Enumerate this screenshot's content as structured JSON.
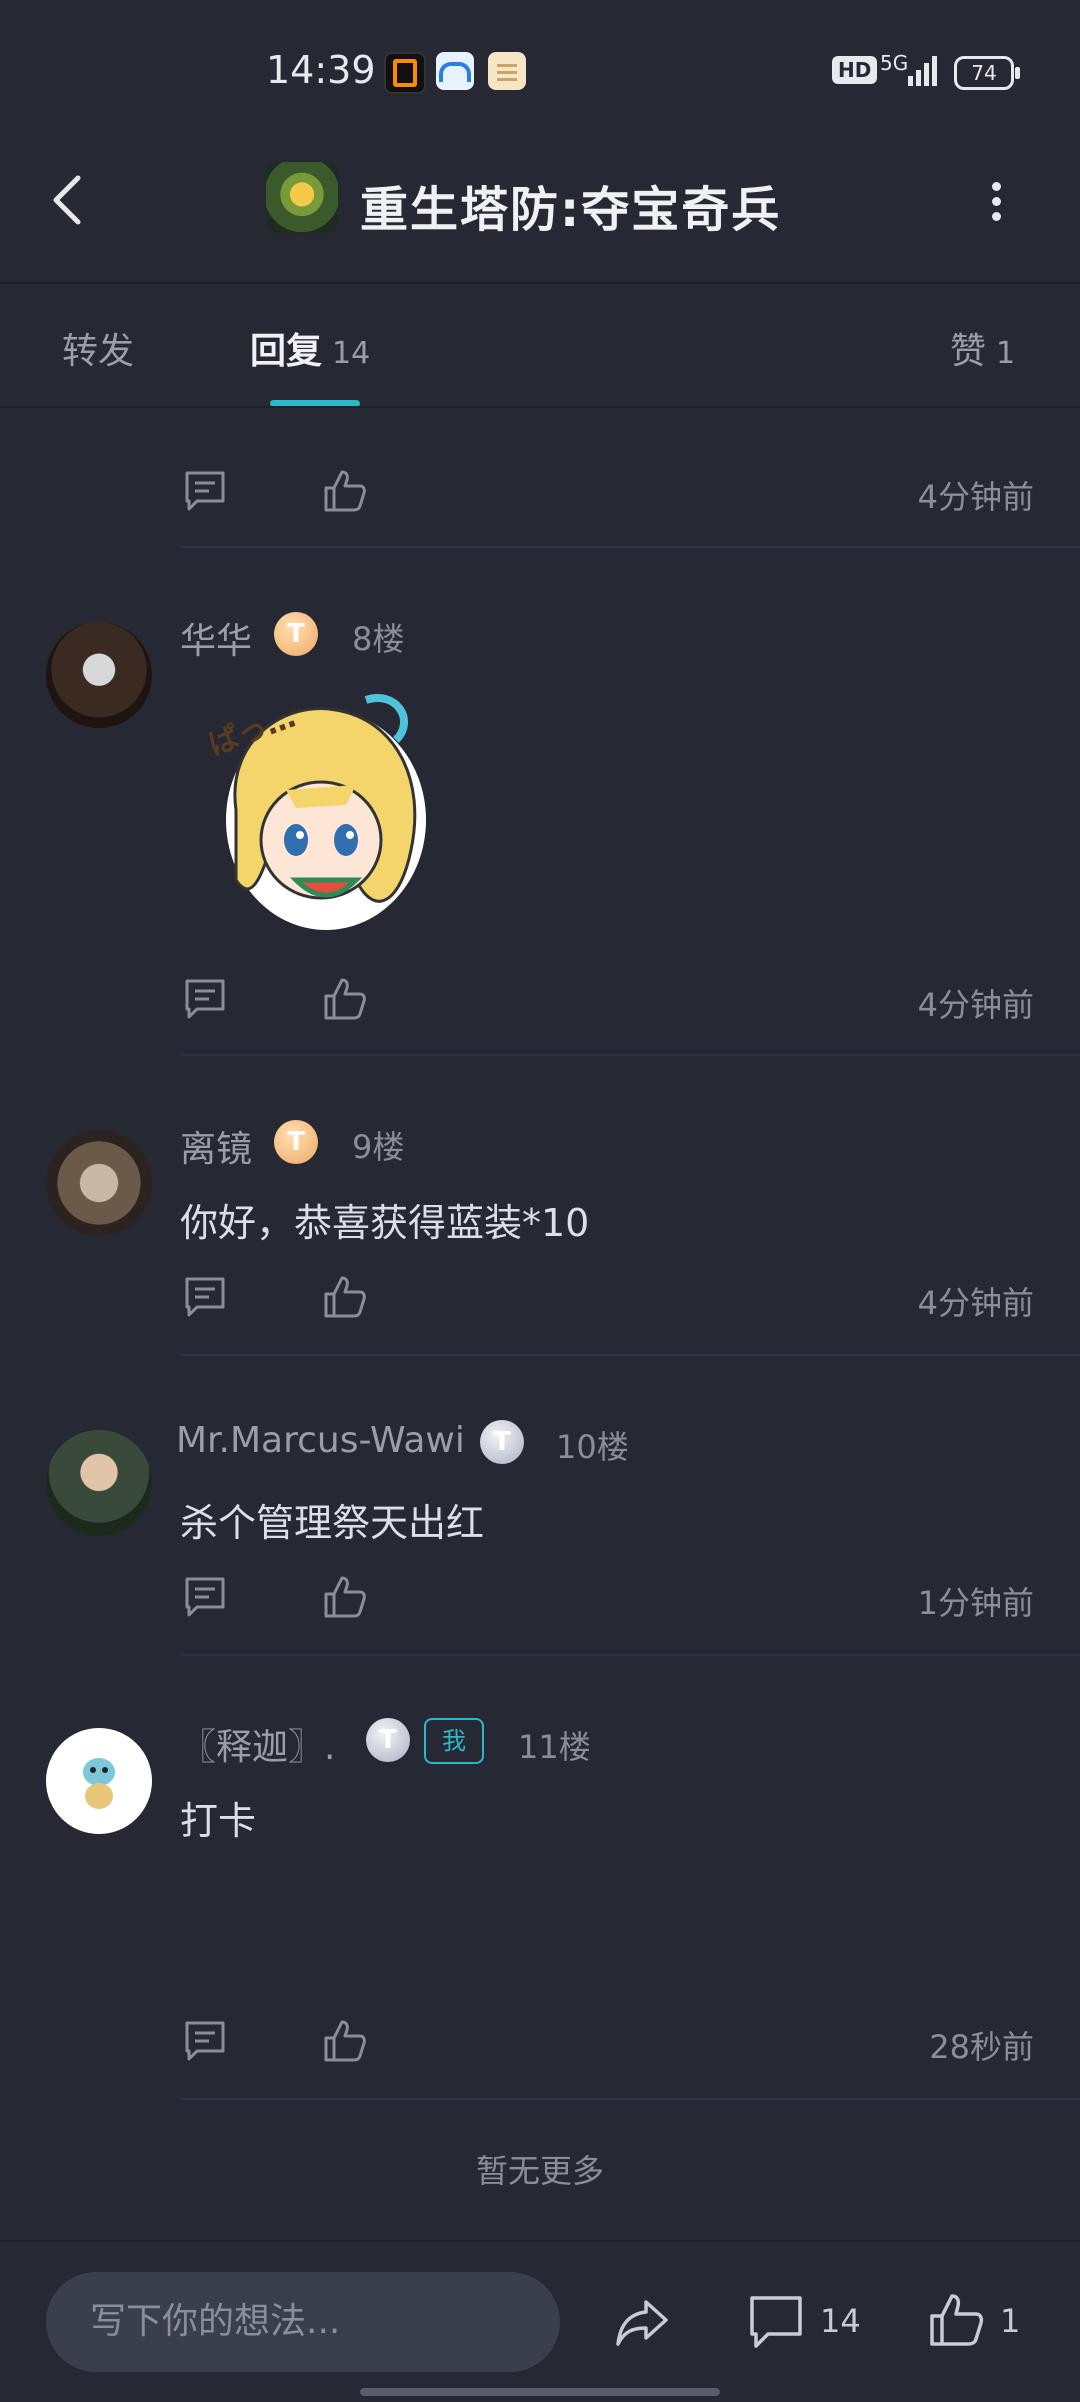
{
  "status_bar": {
    "time": "14:39",
    "hd": "HD",
    "network": "5G",
    "battery": "74"
  },
  "header": {
    "title": "重生塔防:夺宝奇兵"
  },
  "tabs": [
    {
      "label": "转发",
      "count": ""
    },
    {
      "label": "回复",
      "count": "14"
    },
    {
      "label": "赞",
      "count": "1"
    }
  ],
  "comments": [
    {
      "name": "",
      "floor": "",
      "text": "",
      "time": "4分钟前"
    },
    {
      "name": "华华",
      "badge": "T",
      "floor": "8楼",
      "text": "",
      "sticker": "anime-girl-watermelon-sticker",
      "sticker_text": "ぱっ…",
      "time": "4分钟前"
    },
    {
      "name": "离镜",
      "badge": "T",
      "floor": "9楼",
      "text": "你好，恭喜获得蓝装*10",
      "time": "4分钟前"
    },
    {
      "name": "Mr.Marcus-Wawi",
      "badge": "T",
      "floor": "10楼",
      "text": "杀个管理祭天出红",
      "time": "1分钟前"
    },
    {
      "name": "〖释迦〗.",
      "badge": "T",
      "me_tag": "我",
      "floor": "11楼",
      "text": "打卡",
      "time": "28秒前"
    }
  ],
  "no_more": "暂无更多",
  "bottom_bar": {
    "input_placeholder": "写下你的想法...",
    "comment_count": "14",
    "like_count": "1"
  },
  "colors": {
    "background": "#262833",
    "accent": "#2bb8c9",
    "badge_gold": "#f0a865",
    "badge_silver": "#a9b0bf"
  }
}
